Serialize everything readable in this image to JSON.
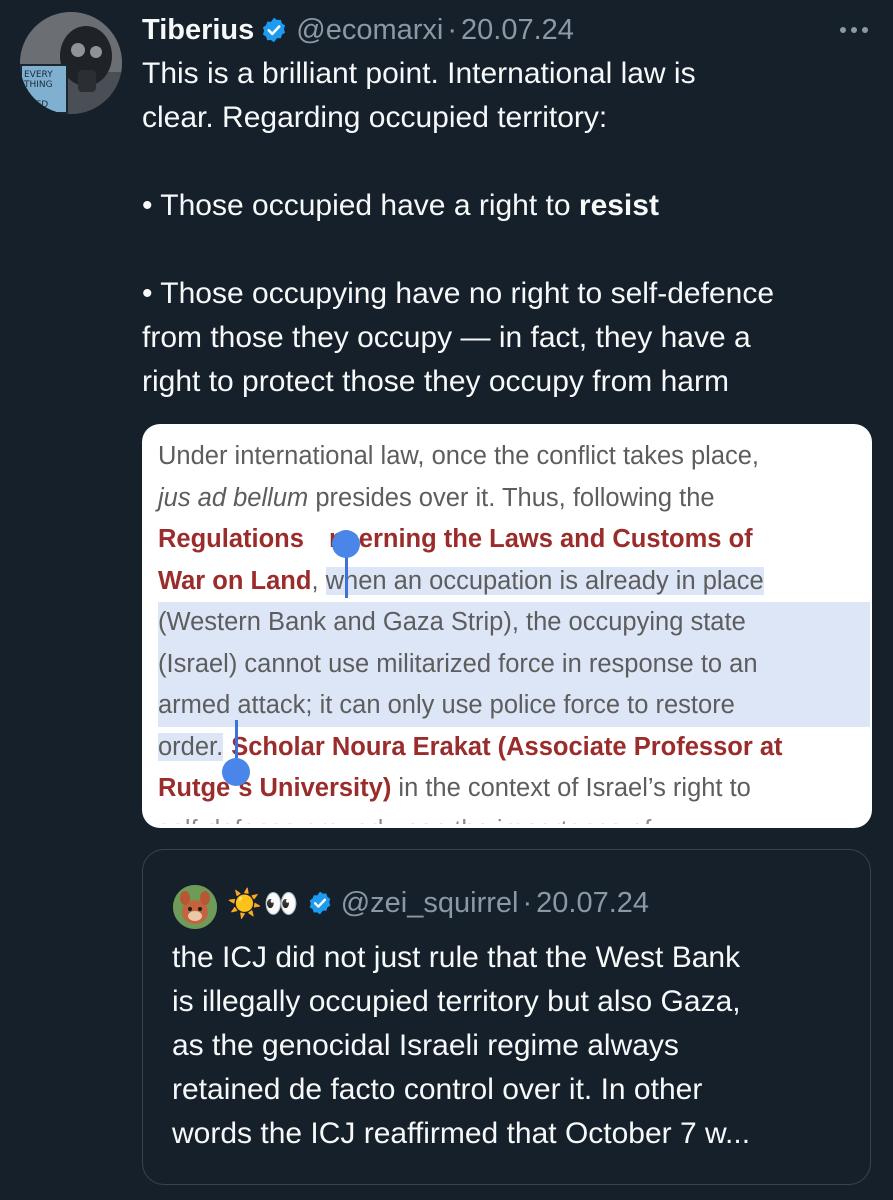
{
  "tweet": {
    "display_name": "Tiberius",
    "handle": "@ecomarxi",
    "separator": "·",
    "date": "20.07.24",
    "avatar_text": [
      "EVERY",
      "THING",
      "SKED"
    ],
    "text": {
      "intro_line1": "This is a brilliant point. International law is",
      "intro_line2": "clear. Regarding occupied territory:",
      "bullet1_prefix": "• Those occupied have a right to ",
      "bullet1_bold": "resist",
      "bullet2_line1": "• Those occupying have no right to self-defence",
      "bullet2_line2": "from those they occupy — in fact, they have a",
      "bullet2_line3": "right to protect those they occupy from harm"
    },
    "image": {
      "l1": "Under international law, once the conflict takes place,",
      "l2_italic": "jus ad bellum",
      "l2_rest": " presides over it. Thus, following the",
      "l3_red_a": "Regulations ",
      "l3_red_b": "ncerning the Laws and Customs of",
      "l4_red": "War on Land",
      "l4_comma": ", ",
      "l4_rest": "when an occupation is already in place",
      "l5": "(Western Bank and Gaza Strip), the occupying state",
      "l6": "(Israel) cannot use militarized force in response to an",
      "l7": "armed attack; it can only use police force to restore",
      "l8_plain": "order.",
      "l8_red": "Scholar Noura Erakat (Associate Professor at",
      "l9_red_a": "Rutge",
      "l9_red_b": "s University)",
      "l9_rest": " in the context of Israel’s right to",
      "l10": "self-defense argued upon the importance of"
    }
  },
  "quoted": {
    "display_name": "☀️👀",
    "handle": "@zei_squirrel",
    "separator": "·",
    "date": "20.07.24",
    "text_lines": [
      "the ICJ did not just rule that the West Bank",
      "is illegally occupied territory but also Gaza,",
      "as the genocidal Israeli regime always",
      "retained de facto control over it. In other",
      "words the ICJ reaffirmed that October 7 w..."
    ]
  },
  "icons": [
    "verified-badge-icon",
    "more-options-icon"
  ],
  "colors": {
    "background": "#15202b",
    "text": "#f7f9f9",
    "secondary": "#8b98a5",
    "verified": "#1d9bf0",
    "quote_border": "#38444d",
    "image_red": "#9b2c2c",
    "selection": "#dce6f6",
    "selection_handle": "#4a85ea"
  }
}
